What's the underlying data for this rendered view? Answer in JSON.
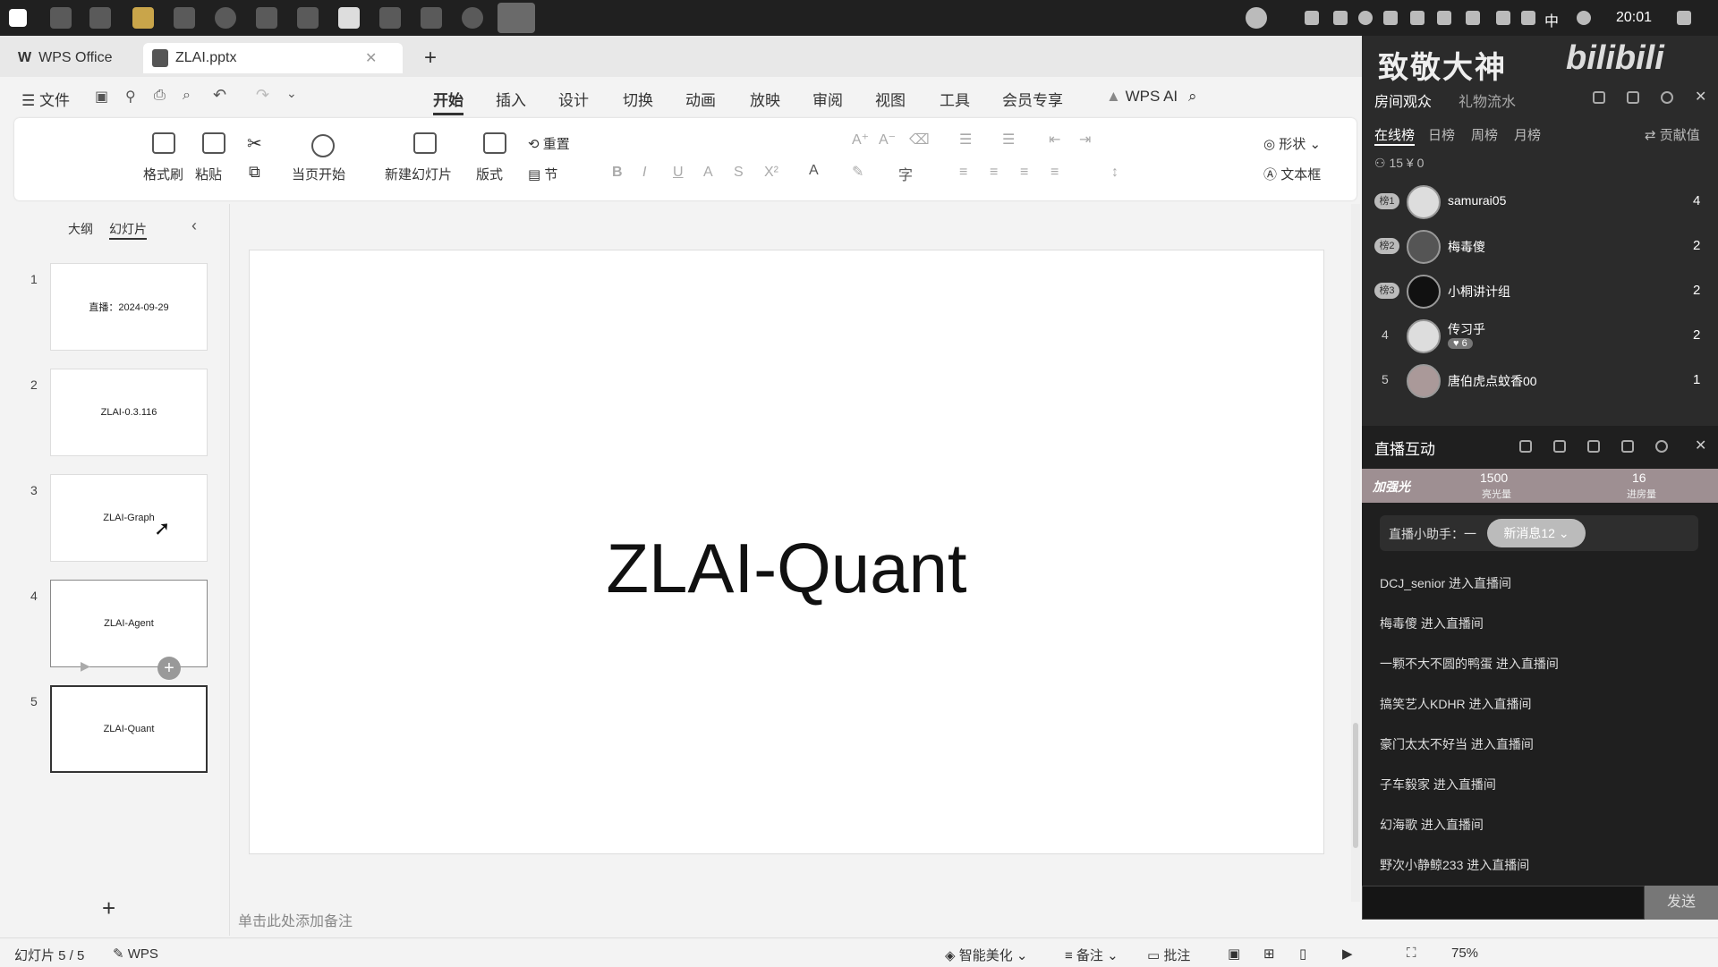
{
  "taskbar": {
    "clock": "20:01",
    "ime": "中"
  },
  "tabs": {
    "home": "WPS Office",
    "doc": "ZLAI.pptx",
    "add": "+"
  },
  "menu": {
    "file": "文件",
    "tabs": [
      "开始",
      "插入",
      "设计",
      "切换",
      "动画",
      "放映",
      "审阅",
      "视图",
      "工具",
      "会员专享"
    ],
    "ai": "WPS AI"
  },
  "ribbon": {
    "format_painter": "格式刷",
    "paste": "粘贴",
    "play_from_current": "当页开始",
    "new_slide": "新建幻灯片",
    "layout": "版式",
    "reset": "重置",
    "section": "节",
    "shape": "形状",
    "textbox": "文本框"
  },
  "left_panel": {
    "outline_tab": "大纲",
    "slides_tab": "幻灯片",
    "slides": [
      {
        "num": "1",
        "title": "直播：2024-09-29"
      },
      {
        "num": "2",
        "title": "ZLAI-0.3.116"
      },
      {
        "num": "3",
        "title": "ZLAI-Graph"
      },
      {
        "num": "4",
        "title": "ZLAI-Agent"
      },
      {
        "num": "5",
        "title": "ZLAI-Quant"
      }
    ],
    "add": "+"
  },
  "slide": {
    "title": "ZLAI-Quant"
  },
  "notes_placeholder": "单击此处添加备注",
  "status": {
    "slide_count": "幻灯片 5 / 5",
    "wps": "WPS",
    "beautify": "智能美化",
    "notes": "备注",
    "comment": "批注",
    "zoom": "75%"
  },
  "live_overlay": {
    "watermark": "致敬大神",
    "brand": "bilibili",
    "audience_tabs": [
      "房间观众",
      "礼物流水"
    ],
    "rank_tabs": [
      "在线榜",
      "日榜",
      "周榜",
      "月榜"
    ],
    "contribution": "贡献值",
    "online_count": "15",
    "currency": "¥ 0",
    "ranking": [
      {
        "rank": "榜1",
        "name": "samurai05",
        "score": "4"
      },
      {
        "rank": "榜2",
        "name": "梅毒傻",
        "score": "2"
      },
      {
        "rank": "榜3",
        "name": "小桐讲计组",
        "score": "2"
      },
      {
        "rank": "4",
        "name": "传习乎",
        "score": "2",
        "level": "6"
      },
      {
        "rank": "5",
        "name": "唐伯虎点蚊香00",
        "score": "1"
      }
    ]
  },
  "interaction": {
    "title": "直播互动",
    "fan_light": "加强光",
    "light_value": "1500",
    "light_label": "亮光量",
    "room_value": "16",
    "room_label": "进房量",
    "assistant": "直播小助手：一",
    "new_messages": "新消息12",
    "messages": [
      "DCJ_senior 进入直播间",
      "梅毒傻 进入直播间",
      "一颗不大不圆的鸭蛋 进入直播间",
      "搞笑艺人KDHR 进入直播间",
      "豪门太太不好当 进入直播间",
      "子车毅家 进入直播间",
      "幻海歌 进入直播间",
      "野次小静鲸233 进入直播间"
    ],
    "send": "发送"
  }
}
